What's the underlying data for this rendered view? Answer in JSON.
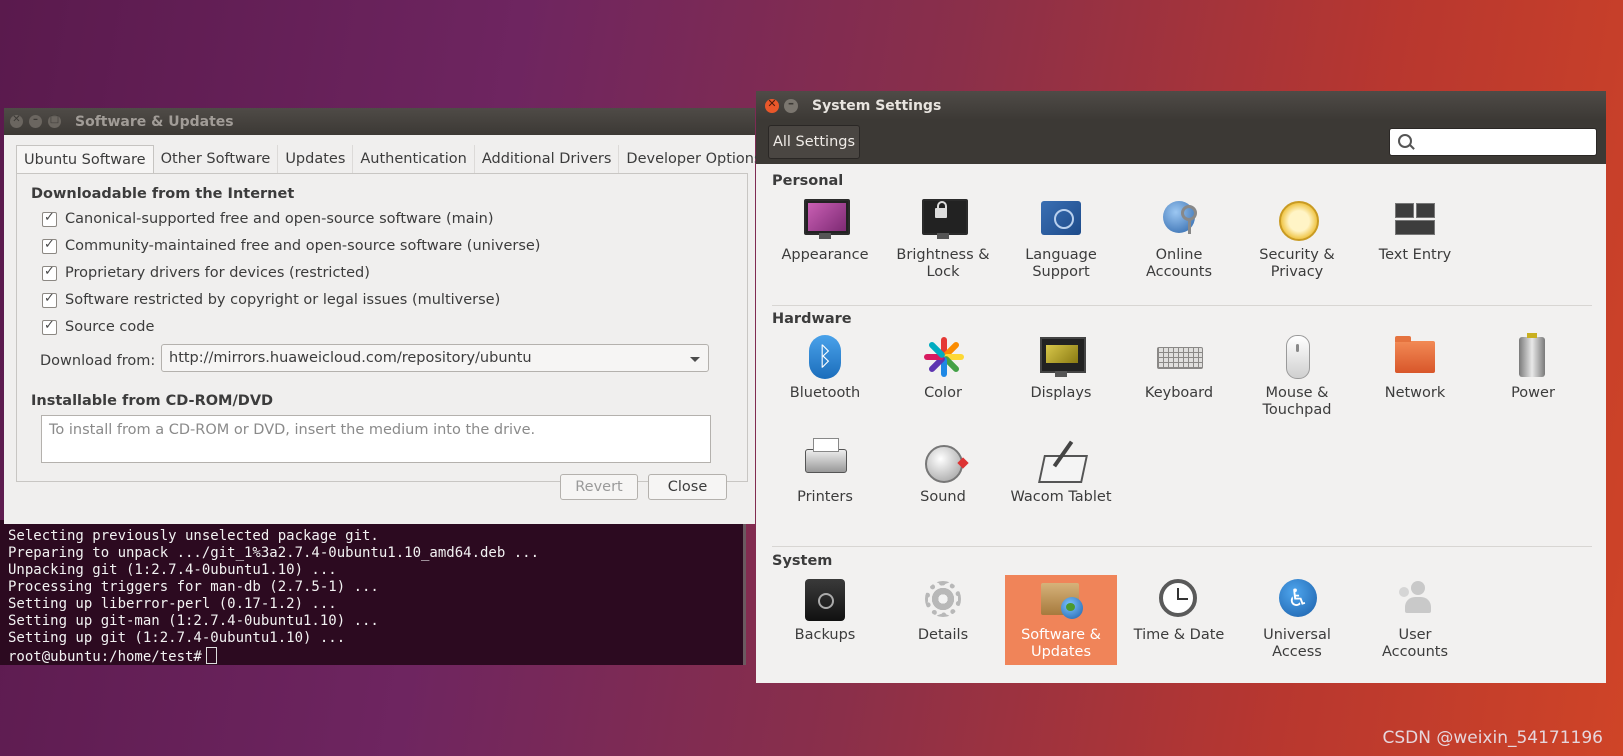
{
  "terminal": {
    "lines": [
      "Selecting previously unselected package git.",
      "Preparing to unpack .../git_1%3a2.7.4-0ubuntu1.10_amd64.deb ...",
      "Unpacking git (1:2.7.4-0ubuntu1.10) ...",
      "Processing triggers for man-db (2.7.5-1) ...",
      "Setting up liberror-perl (0.17-1.2) ...",
      "Setting up git-man (1:2.7.4-0ubuntu1.10) ...",
      "Setting up git (1:2.7.4-0ubuntu1.10) ..."
    ],
    "prompt": "root@ubuntu:/home/test#"
  },
  "software_updates": {
    "title": "Software & Updates",
    "tabs": [
      {
        "label": "Ubuntu Software",
        "active": true
      },
      {
        "label": "Other Software"
      },
      {
        "label": "Updates"
      },
      {
        "label": "Authentication"
      },
      {
        "label": "Additional Drivers"
      },
      {
        "label": "Developer Options"
      }
    ],
    "downloadable_heading": "Downloadable from the Internet",
    "checks": [
      {
        "label": "Canonical-supported free and open-source software (main)",
        "checked": true
      },
      {
        "label": "Community-maintained free and open-source software (universe)",
        "checked": true
      },
      {
        "label": "Proprietary drivers for devices (restricted)",
        "checked": true
      },
      {
        "label": "Software restricted by copyright or legal issues (multiverse)",
        "checked": true
      },
      {
        "label": "Source code",
        "checked": true
      }
    ],
    "download_from_label": "Download from:",
    "download_from_value": "http://mirrors.huaweicloud.com/repository/ubuntu",
    "cdrom_heading": "Installable from CD-ROM/DVD",
    "cdrom_hint": "To install from a CD-ROM or DVD, insert the medium into the drive.",
    "revert_label": "Revert",
    "close_label": "Close"
  },
  "system_settings": {
    "title": "System Settings",
    "all_settings_label": "All Settings",
    "search_placeholder": "",
    "personal_heading": "Personal",
    "hardware_heading": "Hardware",
    "system_heading": "System",
    "personal": [
      {
        "label": "Appearance",
        "icon": "appearance-icon"
      },
      {
        "label": "Brightness &\nLock",
        "icon": "brightness-lock-icon"
      },
      {
        "label": "Language\nSupport",
        "icon": "language-support-icon"
      },
      {
        "label": "Online\nAccounts",
        "icon": "online-accounts-icon"
      },
      {
        "label": "Security &\nPrivacy",
        "icon": "security-privacy-icon"
      },
      {
        "label": "Text Entry",
        "icon": "text-entry-icon"
      }
    ],
    "hardware": [
      {
        "label": "Bluetooth",
        "icon": "bluetooth-icon"
      },
      {
        "label": "Color",
        "icon": "color-icon"
      },
      {
        "label": "Displays",
        "icon": "displays-icon"
      },
      {
        "label": "Keyboard",
        "icon": "keyboard-icon"
      },
      {
        "label": "Mouse &\nTouchpad",
        "icon": "mouse-icon"
      },
      {
        "label": "Network",
        "icon": "network-icon"
      },
      {
        "label": "Power",
        "icon": "power-icon"
      },
      {
        "label": "Printers",
        "icon": "printer-icon"
      },
      {
        "label": "Sound",
        "icon": "sound-icon"
      },
      {
        "label": "Wacom Tablet",
        "icon": "wacom-tablet-icon"
      }
    ],
    "system": [
      {
        "label": "Backups",
        "icon": "backups-icon"
      },
      {
        "label": "Details",
        "icon": "details-icon"
      },
      {
        "label": "Software &\nUpdates",
        "icon": "software-updates-icon",
        "selected": true
      },
      {
        "label": "Time & Date",
        "icon": "time-date-icon"
      },
      {
        "label": "Universal\nAccess",
        "icon": "universal-access-icon"
      },
      {
        "label": "User\nAccounts",
        "icon": "user-accounts-icon"
      }
    ],
    "selected_color": "#f08459"
  },
  "watermark": "CSDN @weixin_54171196"
}
